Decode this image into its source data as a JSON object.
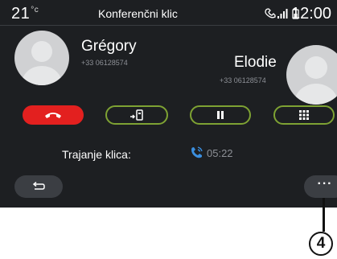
{
  "status_bar": {
    "temperature": "21",
    "temperature_unit": "°c",
    "title": "Konferenčni klic",
    "time": "12:00",
    "icons": [
      "phone-signal-icon",
      "battery-icon"
    ]
  },
  "callers": [
    {
      "name": "Grégory",
      "number": "+33 06128574",
      "avatar_icon": "person-avatar-icon"
    },
    {
      "name": "Elodie",
      "number": "+33 06128574",
      "avatar_icon": "person-avatar-icon"
    }
  ],
  "actions": [
    {
      "id": "hang-up",
      "icon": "hang-up-icon"
    },
    {
      "id": "transfer",
      "icon": "transfer-call-icon"
    },
    {
      "id": "pause",
      "icon": "pause-icon"
    },
    {
      "id": "keypad",
      "icon": "keypad-icon"
    }
  ],
  "duration": {
    "label": "Trajanje klica:",
    "value": "05:22",
    "icon": "call-active-icon"
  },
  "nav": {
    "back_icon": "back-arrow-icon",
    "more_label": "···"
  },
  "callout": {
    "number": "4"
  },
  "colors": {
    "background": "#1d1f22",
    "hangup_red": "#e3201f",
    "accent_green": "#7ea233",
    "call_icon_blue": "#3b8fe0",
    "muted_text": "#8d9096",
    "round_button": "#3b3e43"
  }
}
